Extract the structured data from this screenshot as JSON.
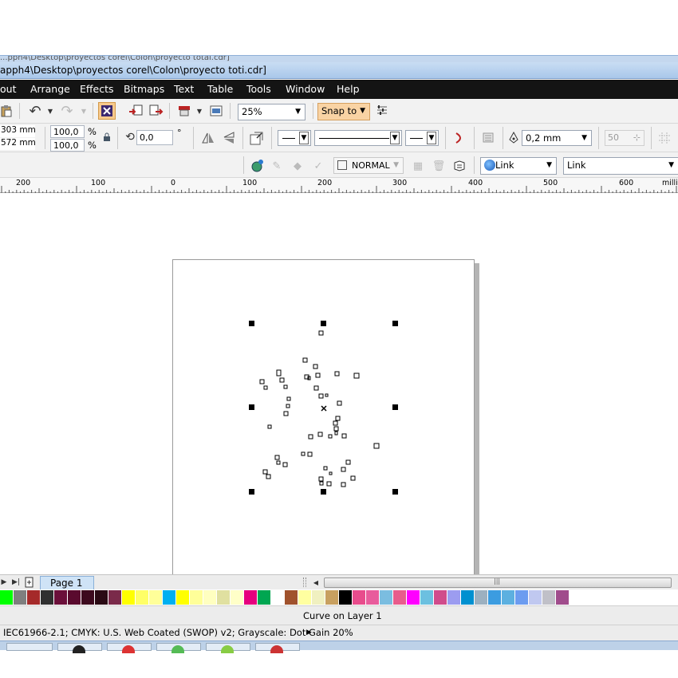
{
  "window": {
    "back_title": "...pph4\\Desktop\\proyectos corel\\Colon\\proyecto total.cdr]",
    "title": "apph4\\Desktop\\proyectos corel\\Colon\\proyecto toti.cdr]"
  },
  "menu": {
    "items": [
      "out",
      "Arrange",
      "Effects",
      "Bitmaps",
      "Text",
      "Table",
      "Tools",
      "Window",
      "Help"
    ]
  },
  "toolbar": {
    "zoom": "25%",
    "snap_to": "Snap to"
  },
  "property_bar": {
    "size_w": "303 mm",
    "size_h": "572 mm",
    "scale_x": "100,0",
    "scale_y": "100,0",
    "percent": "%",
    "rotation": "0,0",
    "degree": "°",
    "outline_width": "0,2 mm",
    "stepper_value": "50"
  },
  "object_bar": {
    "blend_mode": "NORMAL",
    "link_dropdown": "Link",
    "link_field": "Link"
  },
  "ruler": {
    "ticks": [
      "200",
      "100",
      "0",
      "100",
      "200",
      "300",
      "400",
      "500",
      "600"
    ],
    "unit": "millim"
  },
  "page_tab": {
    "label": "Page 1"
  },
  "palette": {
    "colors": [
      "#00ff00",
      "#7f7f7f",
      "#a52a2a",
      "#303030",
      "#6b0f3a",
      "#5a0a2e",
      "#3d0a1e",
      "#2a0a14",
      "#7a2a4a",
      "#ffff00",
      "#ffff66",
      "#ffff99",
      "#00b0f0",
      "#ffff00",
      "#ffff99",
      "#ffffc0",
      "#e0e0a0",
      "#ffffc8",
      "#e6007e",
      "#00a651",
      "#ffffff",
      "#a0522d",
      "#ffffa0",
      "#f0f0c0",
      "#c8a060",
      "#000000",
      "#e84c8c",
      "#e85c9c",
      "#7bbde0",
      "#e85c8c",
      "#ff00ff",
      "#6cc0e0",
      "#d04c8c",
      "#9c9cf0",
      "#0090d0",
      "#9cb0c0",
      "#3c9ce0",
      "#5cb0e0",
      "#6c9cf0",
      "#c0c8f0",
      "#c0c0c8",
      "#a04c8c"
    ]
  },
  "status": {
    "object_info": "Curve on Layer 1",
    "color_profile": "IEC61966-2.1; CMYK: U.S. Web Coated (SWOP) v2; Grayscale: Dot Gain 20%"
  }
}
